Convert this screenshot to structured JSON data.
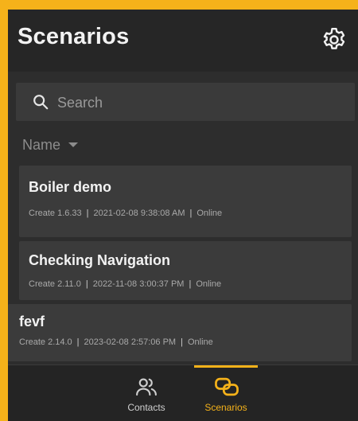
{
  "header": {
    "title": "Scenarios",
    "settings_icon": "gear-icon"
  },
  "search": {
    "placeholder": "Search",
    "value": ""
  },
  "sort": {
    "label": "Name"
  },
  "scenarios": [
    {
      "name": "Boiler demo",
      "version": "Create 1.6.33",
      "timestamp": "2021-02-08 9:38:08 AM",
      "status": "Online"
    },
    {
      "name": "Checking Navigation",
      "version": "Create 2.11.0",
      "timestamp": "2022-11-08 3:00:37 PM",
      "status": "Online"
    },
    {
      "name": "fevf",
      "version": "Create 2.14.0",
      "timestamp": "2023-02-08 2:57:06 PM",
      "status": "Online"
    }
  ],
  "separator": "|",
  "nav": {
    "contacts_label": "Contacts",
    "scenarios_label": "Scenarios",
    "active": "scenarios"
  },
  "colors": {
    "accent": "#f5b21a",
    "background": "#2d2d2d",
    "card": "#3b3b3b",
    "text": "#f2f2f2",
    "muted": "#a9a9a9"
  }
}
